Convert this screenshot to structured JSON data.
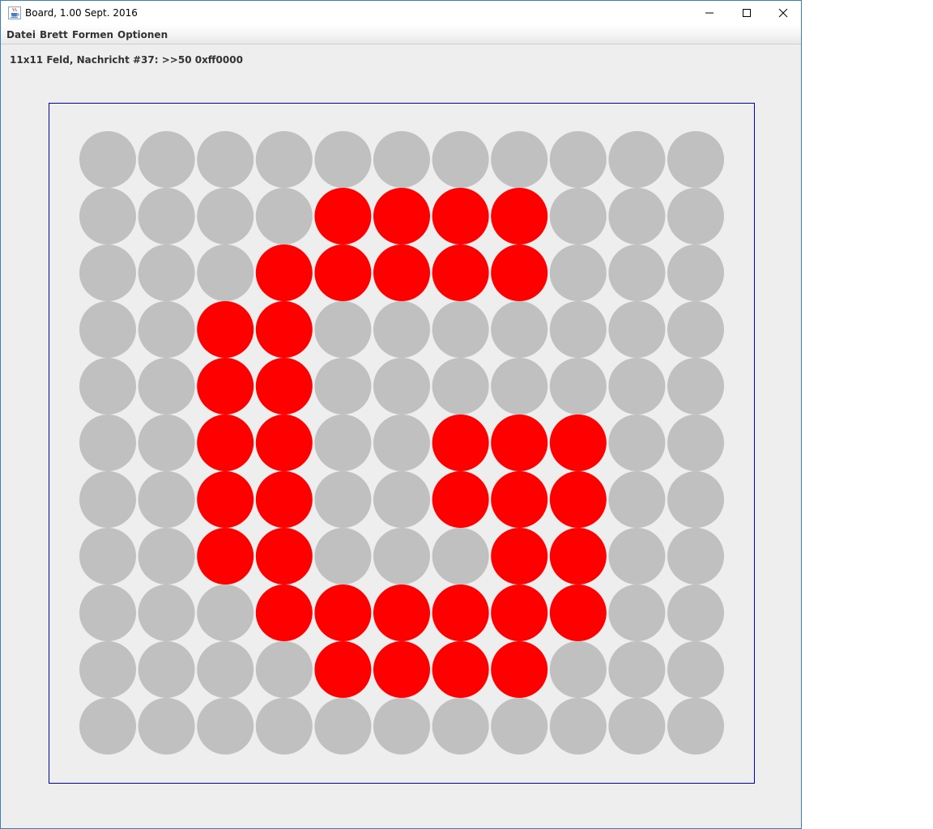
{
  "window": {
    "title": "Board, 1.00 Sept. 2016"
  },
  "menu": {
    "items": [
      "Datei",
      "Brett",
      "Formen",
      "Optionen"
    ]
  },
  "status": {
    "message": "11x11 Feld, Nachricht #37: >>50 0xff0000"
  },
  "board": {
    "rows": 11,
    "cols": 11,
    "colors": {
      "off": "#c0c0c0",
      "on": "#ff0000",
      "border": "#0000cc",
      "background": "#eeeeee"
    },
    "grid": [
      [
        0,
        0,
        0,
        0,
        0,
        0,
        0,
        0,
        0,
        0,
        0
      ],
      [
        0,
        0,
        0,
        0,
        1,
        1,
        1,
        1,
        0,
        0,
        0
      ],
      [
        0,
        0,
        0,
        1,
        1,
        1,
        1,
        1,
        0,
        0,
        0
      ],
      [
        0,
        0,
        1,
        1,
        0,
        0,
        0,
        0,
        0,
        0,
        0
      ],
      [
        0,
        0,
        1,
        1,
        0,
        0,
        0,
        0,
        0,
        0,
        0
      ],
      [
        0,
        0,
        1,
        1,
        0,
        0,
        1,
        1,
        1,
        0,
        0
      ],
      [
        0,
        0,
        1,
        1,
        0,
        0,
        1,
        1,
        1,
        0,
        0
      ],
      [
        0,
        0,
        1,
        1,
        0,
        0,
        0,
        1,
        1,
        0,
        0
      ],
      [
        0,
        0,
        0,
        1,
        1,
        1,
        1,
        1,
        1,
        0,
        0
      ],
      [
        0,
        0,
        0,
        0,
        1,
        1,
        1,
        1,
        0,
        0,
        0
      ],
      [
        0,
        0,
        0,
        0,
        0,
        0,
        0,
        0,
        0,
        0,
        0
      ]
    ]
  },
  "icons": {
    "app": "java-cup-icon",
    "minimize": "minimize-icon",
    "maximize": "maximize-icon",
    "close": "close-icon"
  }
}
